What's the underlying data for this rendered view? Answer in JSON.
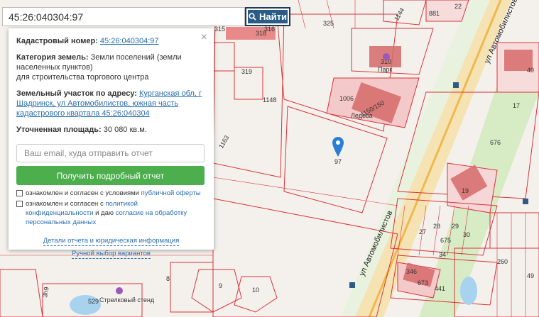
{
  "search": {
    "value": "45:26:040304:97",
    "button_label": "Найти"
  },
  "info": {
    "cadastral_label": "Кадастровый номер:",
    "cadastral_value": "45:26:040304:97",
    "category_label": "Категория земель:",
    "category_value": "Земли поселений (земли населенных пунктов)",
    "category_purpose": "для строительства торгового центра",
    "address_label": "Земельный участок по адресу:",
    "address_value": "Курганская обл, г Шадринск, ул Автомобилистов, южная часть кадастрового квартала 45:26:040304",
    "area_label": "Уточненная площадь:",
    "area_value": "30 080 кв.м."
  },
  "form": {
    "email_placeholder": "Ваш email, куда отправить отчет",
    "submit_label": "Получить подробный отчет",
    "consent1_prefix": "ознакомлен и согласен с условиями",
    "consent1_link": "публичной оферты",
    "consent2_prefix": "ознакомлен и согласен с",
    "consent2_link1": "политикой конфиденциальности",
    "consent2_middle": "и даю",
    "consent2_link2": "согласие на обработку персональных данных"
  },
  "links": {
    "details": "Детали отчета и юридическая информация",
    "manual": "Ручной выбор вариантов"
  },
  "map": {
    "street_name_1": "ул Автомобилистов",
    "street_name_2": "ул Автомобилистов",
    "parcel_labels": {
      "p325": "325",
      "p318": "318",
      "p316": "316",
      "p315": "315",
      "p1148": "1148",
      "p1006": "1006",
      "p1163": "1163",
      "p310a": "310",
      "p97": "97",
      "p676": "676",
      "p19": "19",
      "p1144": "1144",
      "p881": "881",
      "p22": "22",
      "p40": "40",
      "p17": "17",
      "p27": "27",
      "p28": "28",
      "p29": "29",
      "p30": "30",
      "p675": "675",
      "p34": "34",
      "p346": "346",
      "p673": "673",
      "p441": "441",
      "p9": "9",
      "p10": "10",
      "p8": "8",
      "p529": "529",
      "p3h9": "3h9",
      "p260": "260",
      "p49": "49",
      "p1150": "1150/150",
      "p319": "319"
    },
    "poi_park": "Парк",
    "poi_ice": "Ледова",
    "poi_stand": "Стрелковый стенд",
    "colors": {
      "parcel_line": "#d9343a",
      "road": "#f3c96b",
      "green": "#d7ecc5",
      "building": "#d66a6a"
    }
  }
}
